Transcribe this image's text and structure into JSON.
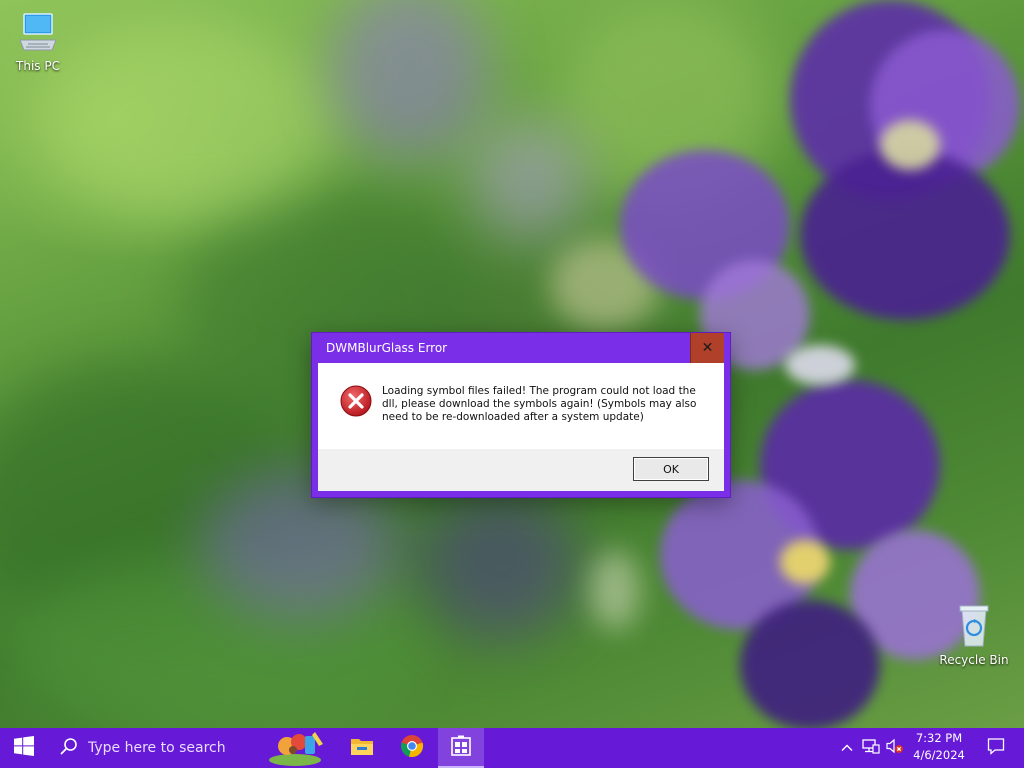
{
  "desktop": {
    "icons": [
      {
        "label": "This PC",
        "icon": "this-pc-icon"
      },
      {
        "label": "Recycle Bin",
        "icon": "recycle-bin-icon"
      }
    ]
  },
  "dialog": {
    "title": "DWMBlurGlass Error",
    "close_label": "✕",
    "icon": "error-icon",
    "message": "Loading symbol files failed! The program could not load the dll, please download the symbols again! (Symbols may also need to be re-downloaded after a system update)",
    "ok_label": "OK",
    "colors": {
      "frame": "#7a2ee8",
      "close": "#b0402a"
    }
  },
  "taskbar": {
    "search_placeholder": "Type here to search",
    "apps": [
      "widgets-app-icon",
      "file-explorer-icon",
      "chrome-icon",
      "active-app-icon"
    ],
    "tray": {
      "time": "7:32 PM",
      "date": "4/6/2024"
    },
    "colors": {
      "background": "#6619d6"
    }
  }
}
